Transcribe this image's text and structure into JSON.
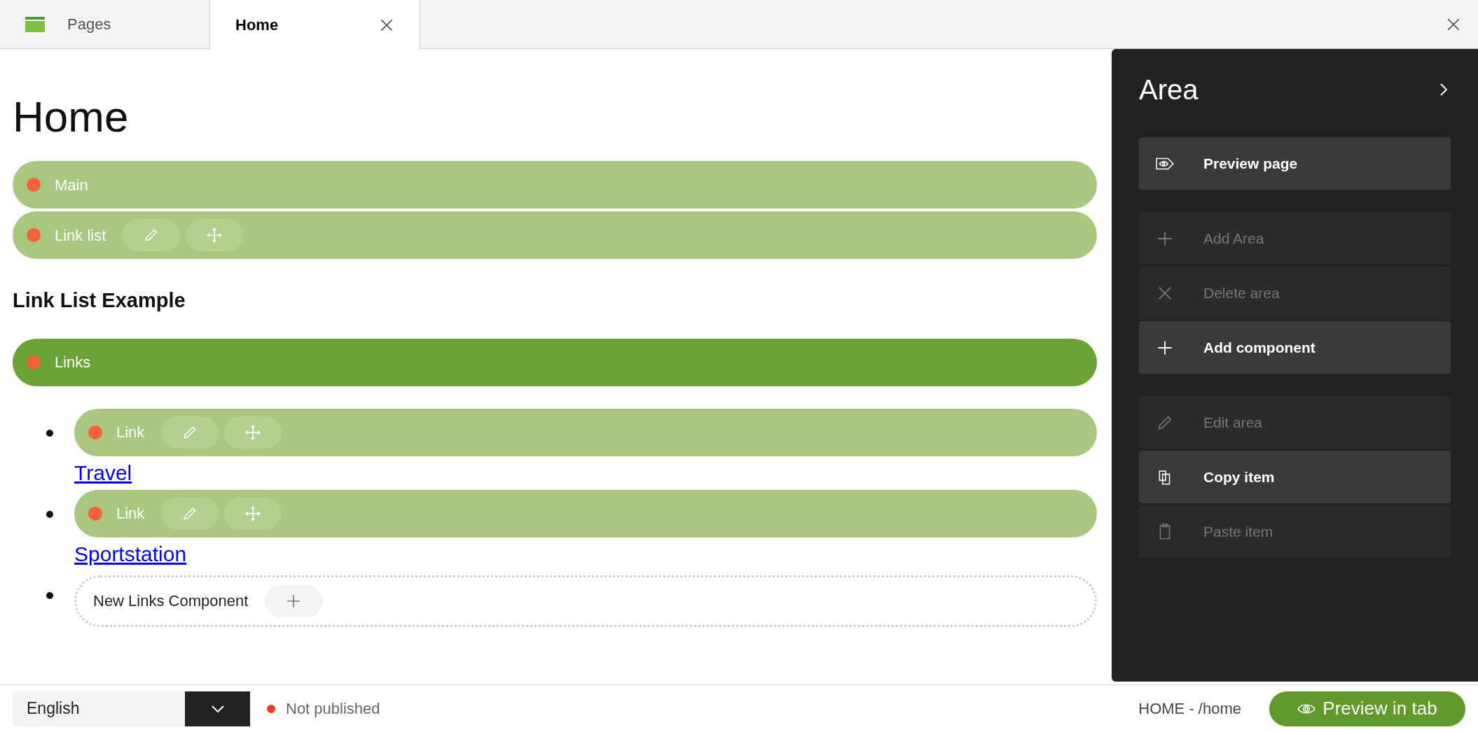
{
  "tabs": [
    {
      "kind": "app",
      "label": "Pages",
      "selected": false
    },
    {
      "kind": "page",
      "label": "Home",
      "selected": true
    }
  ],
  "page": {
    "title": "Home",
    "blocks": [
      {
        "kind": "area",
        "label": "Main",
        "selected": false
      },
      {
        "kind": "component",
        "label": "Link list",
        "selected": false
      },
      {
        "kind": "heading",
        "text": "Link List Example"
      },
      {
        "kind": "area",
        "label": "Links",
        "selected": true
      },
      {
        "kind": "list",
        "items": [
          {
            "kind": "link",
            "bar": {
              "label": "Link",
              "selected": false
            },
            "link": "Travel"
          },
          {
            "kind": "link",
            "bar": {
              "label": "Link",
              "selected": false
            },
            "link": "Sportstation"
          },
          {
            "kind": "new",
            "label": "New Links Component"
          }
        ]
      }
    ]
  },
  "panel": {
    "title": "Area",
    "groups": [
      [
        {
          "label": "Preview page",
          "disabled": false
        }
      ],
      [
        {
          "label": "Add Area",
          "disabled": true
        },
        {
          "label": "Delete area",
          "disabled": true
        },
        {
          "label": "Add component",
          "disabled": false
        }
      ],
      [
        {
          "label": "Edit area",
          "disabled": true
        },
        {
          "label": "Copy item",
          "disabled": false
        },
        {
          "label": "Paste item",
          "disabled": true
        }
      ]
    ]
  },
  "footer": {
    "language": "English",
    "status": "Not published",
    "path": "HOME - /home",
    "preview_button": "Preview in tab"
  }
}
